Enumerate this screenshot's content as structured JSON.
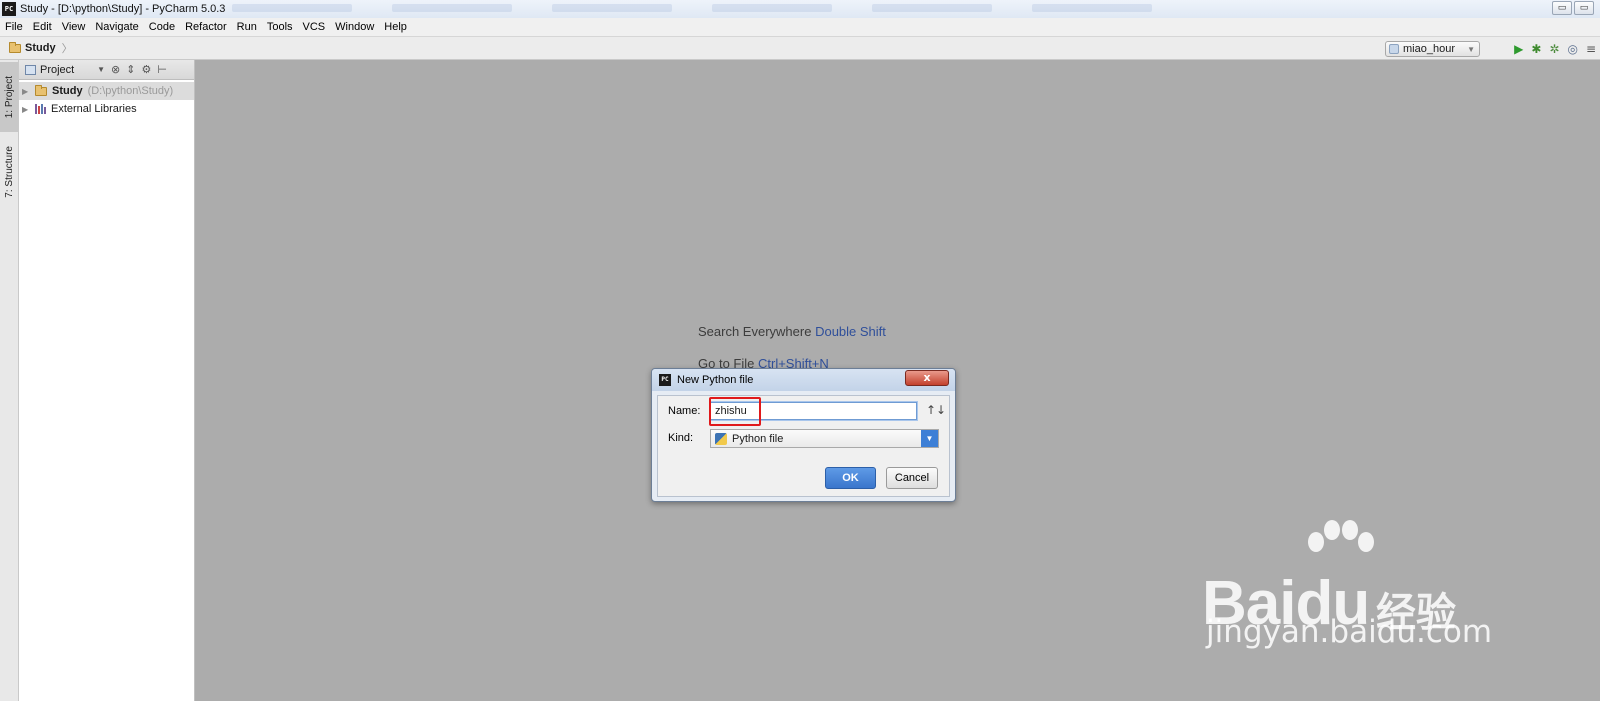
{
  "window": {
    "title": "Study - [D:\\python\\Study] - PyCharm 5.0.3",
    "app_icon_text": "PC",
    "minimize_glyph": "▭",
    "restore_glyph": "▭"
  },
  "menu": [
    "File",
    "Edit",
    "View",
    "Navigate",
    "Code",
    "Refactor",
    "Run",
    "Tools",
    "VCS",
    "Window",
    "Help"
  ],
  "navbar": {
    "breadcrumb": "Study",
    "run_config": "miao_hour"
  },
  "side_tabs": {
    "project": "1: Project",
    "structure": "7: Structure"
  },
  "project_panel": {
    "view_label": "Project",
    "tree": [
      {
        "name": "Study",
        "path": "(D:\\python\\Study)"
      },
      {
        "name": "External Libraries",
        "path": ""
      }
    ]
  },
  "editor_hints": [
    {
      "text": "Search Everywhere",
      "key": "Double Shift"
    },
    {
      "text": "Go to File",
      "key": "Ctrl+Shift+N"
    }
  ],
  "dialog": {
    "title": "New Python file",
    "close_glyph": "x",
    "name_label": "Name:",
    "name_value": "zhishu",
    "kind_label": "Kind:",
    "kind_value": "Python file",
    "ok_label": "OK",
    "cancel_label": "Cancel"
  },
  "watermark": {
    "brand": "Bai",
    "brand_end": "du",
    "brand_cn": "经验",
    "url": "jingyan.baidu.com"
  },
  "colors": {
    "editor_bg": "#acacac",
    "hint_key": "#2f4f9a",
    "ok_button": "#3a76cc",
    "highlight_box": "#e0191b"
  }
}
